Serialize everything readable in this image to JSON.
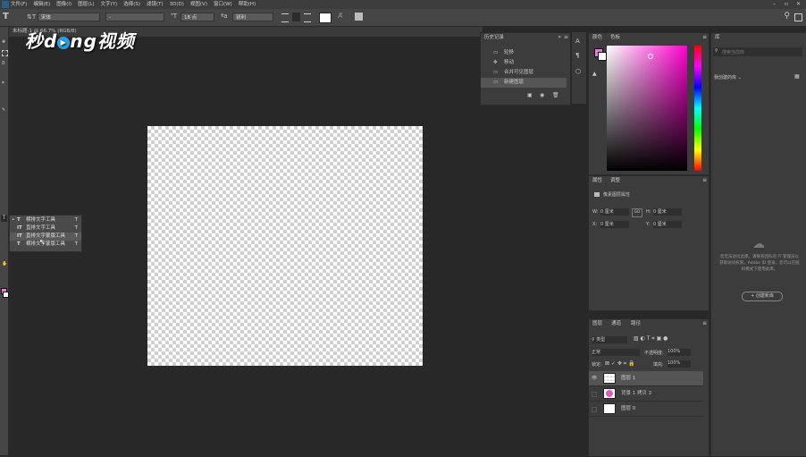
{
  "menubar": {
    "items": [
      "文件(F)",
      "编辑(E)",
      "图像(I)",
      "图层(L)",
      "文字(Y)",
      "选择(S)",
      "滤镜(T)",
      "3D(D)",
      "视图(V)",
      "窗口(W)",
      "帮助(H)"
    ]
  },
  "options": {
    "tool_icon": "T",
    "font_family": "宋体",
    "font_style": "-",
    "font_size": "18 点",
    "aa": "锐利"
  },
  "document": {
    "tab_title": "未标题-1 @ 66.7% (RGB/8)"
  },
  "watermark": {
    "text_a": "秒d",
    "text_o": "▶",
    "text_b": "ng视频"
  },
  "type_flyout": {
    "items": [
      {
        "icon": "T",
        "label": "横排文字工具",
        "shortcut": "T"
      },
      {
        "icon": "IT",
        "label": "直排文字工具",
        "shortcut": "T"
      },
      {
        "icon": "IT",
        "label": "直排文字蒙版工具",
        "shortcut": "T"
      },
      {
        "icon": "T",
        "label": "横排文字蒙版工具",
        "shortcut": "T"
      }
    ]
  },
  "history": {
    "tab": "历史记录",
    "items": [
      {
        "icon": "▭",
        "label": "轮移"
      },
      {
        "icon": "✥",
        "label": "移动"
      },
      {
        "icon": "▭",
        "label": "合并可见图层"
      },
      {
        "icon": "▭",
        "label": "新建图层"
      }
    ]
  },
  "color_panel": {
    "tabs": [
      "颜色",
      "色板"
    ],
    "fg_color": "#e879d6",
    "bg_color": "#ffffff"
  },
  "properties": {
    "tabs": [
      "属性",
      "调整"
    ],
    "title": "像素图层属性",
    "w_label": "W:",
    "w_value": "0 厘米",
    "go": "GO",
    "h_label": "H:",
    "h_value": "0 厘米",
    "x_label": "X:",
    "x_value": "0 厘米",
    "y_label": "Y:",
    "y_value": "0 厘米"
  },
  "library": {
    "tab": "库",
    "search_placeholder": "搜索当前库",
    "dropdown": "我创建的库",
    "message": "您无法访问此库。请联系团队的 IT 管理员以获取访问权限。Adobe ID 登录。您可以在脱机模式下使用此库。",
    "create_button": "+ 创建新库"
  },
  "layers": {
    "tabs": [
      "图层",
      "通道",
      "路径"
    ],
    "filter": "类型",
    "blend_mode": "正常",
    "opacity_label": "不透明度:",
    "opacity": "100%",
    "lock_label": "锁定:",
    "fill_label": "填充:",
    "fill": "100%",
    "rows": [
      {
        "name": "图层 1",
        "visible": "👁"
      },
      {
        "name": "背景 1 拷贝 2",
        "visible": ""
      },
      {
        "name": "图层 0",
        "visible": ""
      }
    ]
  }
}
